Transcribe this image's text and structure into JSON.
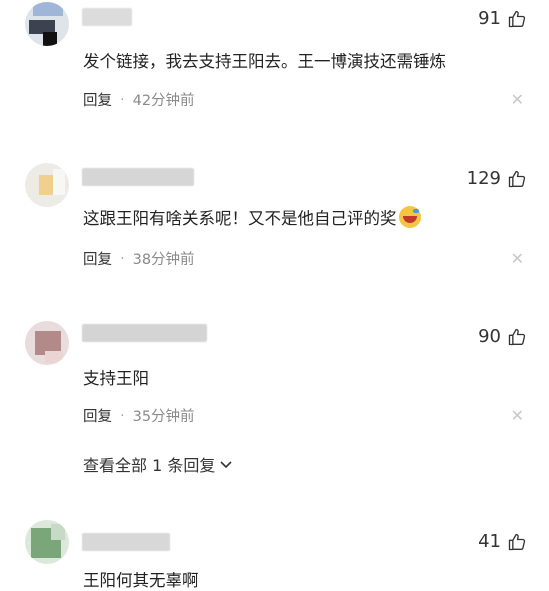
{
  "comments": [
    {
      "likes": "91",
      "text": "发个链接，我去支持王阳去。王一博演技还需锤炼",
      "reply_label": "回复",
      "time": "42分钟前"
    },
    {
      "likes": "129",
      "text": "这跟王阳有啥关系呢！又不是他自己评的奖",
      "reply_label": "回复",
      "time": "38分钟前"
    },
    {
      "likes": "90",
      "text": "支持王阳",
      "reply_label": "回复",
      "time": "35分钟前",
      "view_replies": "查看全部 1 条回复"
    },
    {
      "likes": "41",
      "text": "王阳何其无辜啊"
    }
  ],
  "icons": {
    "like": "thumb-up-icon",
    "close": "close-icon",
    "chevron": "chevron-down-icon",
    "emoji": "laughing-crying-emoji"
  },
  "colors": {
    "text": "#222222",
    "meta": "#8a8a8a",
    "close": "#c8c8c8"
  }
}
